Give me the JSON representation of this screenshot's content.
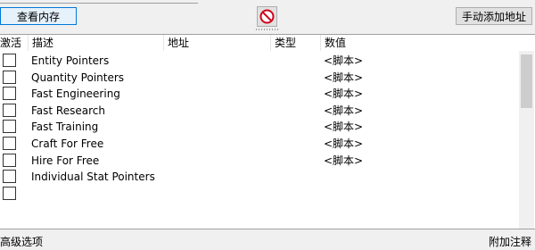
{
  "toolbar": {
    "view_memory_label": "查看内存",
    "add_address_label": "手动添加地址",
    "stop_icon": "no-entry-icon"
  },
  "columns": {
    "active": "激活",
    "description": "描述",
    "address": "地址",
    "type": "类型",
    "value": "数值"
  },
  "rows": [
    {
      "description": "Entity Pointers",
      "value": "<脚本>"
    },
    {
      "description": "Quantity Pointers",
      "value": "<脚本>"
    },
    {
      "description": "Fast Engineering",
      "value": "<脚本>"
    },
    {
      "description": "Fast Research",
      "value": "<脚本>"
    },
    {
      "description": "Fast Training",
      "value": "<脚本>"
    },
    {
      "description": "Craft For Free",
      "value": "<脚本>"
    },
    {
      "description": "Hire For Free",
      "value": "<脚本>"
    },
    {
      "description": "Individual Stat Pointers",
      "value": ""
    },
    {
      "description": "",
      "value": ""
    }
  ],
  "footer": {
    "advanced_options": "高级选项",
    "add_comment": "附加注释"
  },
  "colors": {
    "accent": "#0078d7",
    "stop_icon": "#d0021b"
  }
}
